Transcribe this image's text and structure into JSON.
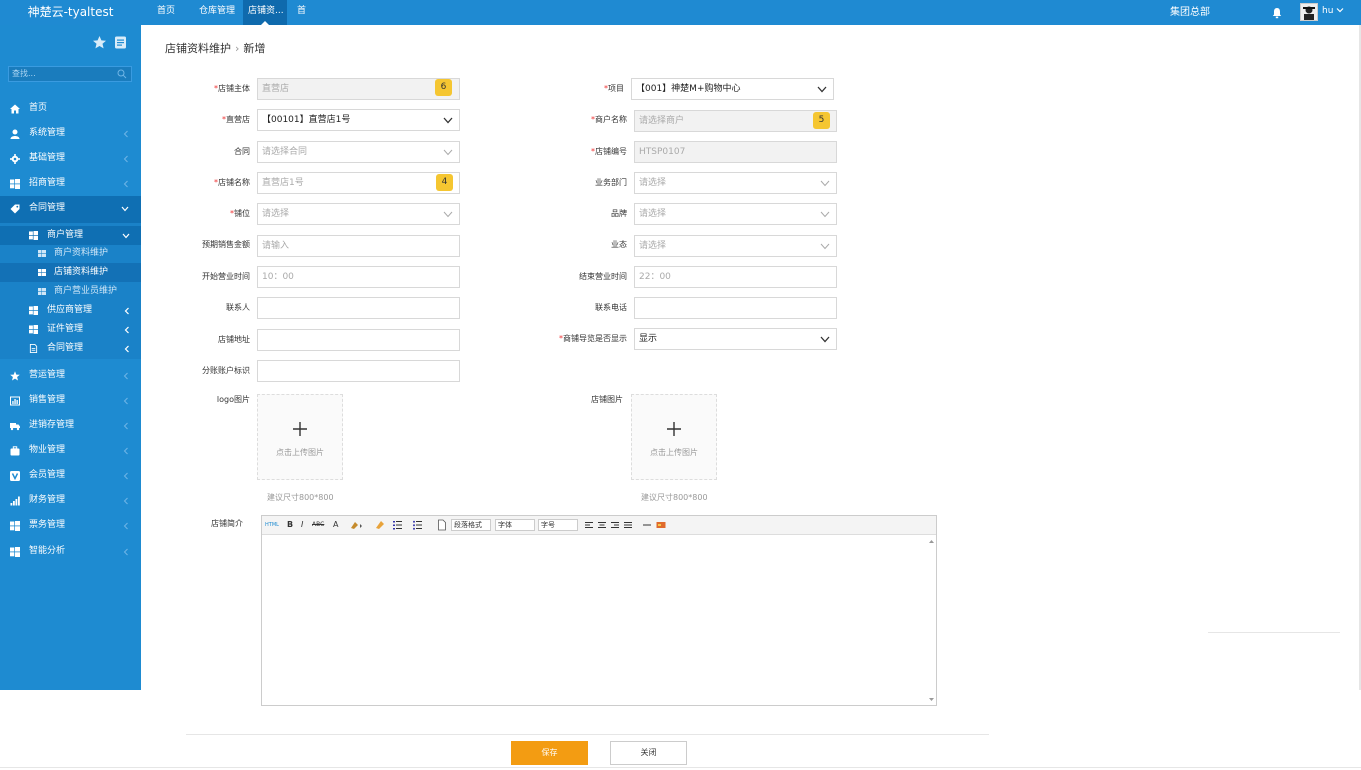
{
  "app": {
    "brand": "神楚云-tyaltest"
  },
  "topnav": {
    "tabs": [
      {
        "label": "首页"
      },
      {
        "label": "仓库管理"
      },
      {
        "label": "店铺资..."
      },
      {
        "label": "首"
      }
    ],
    "org": "集团总部",
    "user": "hu"
  },
  "sidebar": {
    "search_placeholder": "查找...",
    "items": [
      {
        "label": "首页"
      },
      {
        "label": "系统管理"
      },
      {
        "label": "基础管理"
      },
      {
        "label": "招商管理"
      },
      {
        "label": "合同管理"
      },
      {
        "label": "营运管理"
      },
      {
        "label": "销售管理"
      },
      {
        "label": "进销存管理"
      },
      {
        "label": "物业管理"
      },
      {
        "label": "会员管理"
      },
      {
        "label": "财务管理"
      },
      {
        "label": "票务管理"
      },
      {
        "label": "智能分析"
      }
    ],
    "sub": [
      {
        "label": "商户管理"
      },
      {
        "label": "供应商管理"
      },
      {
        "label": "证件管理"
      },
      {
        "label": "合同管理"
      }
    ],
    "leaves": [
      {
        "label": "商户资料维护"
      },
      {
        "label": "店铺资料维护"
      },
      {
        "label": "商户营业员维护"
      }
    ]
  },
  "breadcrumb": {
    "parent": "店铺资料维护",
    "sep": "›",
    "current": "新增"
  },
  "required_mark": "*",
  "form": {
    "store_subject": {
      "label": "店铺主体",
      "placeholder": "直营店",
      "badge": "6"
    },
    "project": {
      "label": "项目",
      "value": "【001】神楚M+购物中心"
    },
    "direct_store": {
      "label": "直营店",
      "value": "【00101】直营店1号"
    },
    "merchant_name": {
      "label": "商户名称",
      "placeholder": "请选择商户",
      "badge": "5"
    },
    "contract": {
      "label": "合同",
      "placeholder": "请选择合同"
    },
    "store_code": {
      "label": "店铺编号",
      "value": "HTSP0107"
    },
    "store_name": {
      "label": "店铺名称",
      "placeholder": "直营店1号",
      "badge": "4"
    },
    "department": {
      "label": "业务部门",
      "placeholder": "请选择"
    },
    "berth": {
      "label": "铺位",
      "placeholder": "请选择"
    },
    "brand": {
      "label": "品牌",
      "placeholder": "请选择"
    },
    "expected_sales": {
      "label": "预期销售金额",
      "placeholder": "请输入"
    },
    "business_format": {
      "label": "业态",
      "placeholder": "请选择"
    },
    "open_time": {
      "label": "开始营业时间",
      "placeholder": "10：00"
    },
    "close_time": {
      "label": "结束营业时间",
      "placeholder": "22：00"
    },
    "contact": {
      "label": "联系人"
    },
    "phone": {
      "label": "联系电话"
    },
    "address": {
      "label": "店铺地址"
    },
    "guide_display": {
      "label": "商铺导览是否显示",
      "value": "显示"
    },
    "split_account": {
      "label": "分账账户标识"
    },
    "logo": {
      "label": "logo图片",
      "upload_text": "点击上传图片",
      "hint": "建议尺寸800*800"
    },
    "store_image": {
      "label": "店铺图片",
      "upload_text": "点击上传图片",
      "hint": "建议尺寸800*800"
    },
    "intro": {
      "label": "店铺简介"
    }
  },
  "editor": {
    "toolbar": {
      "html": "HTML",
      "bold": "B",
      "italic": "I",
      "strike": "ABC",
      "font_color": "A",
      "paragraph": "段落格式",
      "font": "字体",
      "size": "字号"
    }
  },
  "buttons": {
    "save": "保存",
    "close": "关闭"
  },
  "colors": {
    "topbar": "#1f8ad2",
    "sidebar": "#1e8bd1",
    "save": "#f39c12",
    "badge": "#f5c631",
    "required": "#ee3333"
  }
}
